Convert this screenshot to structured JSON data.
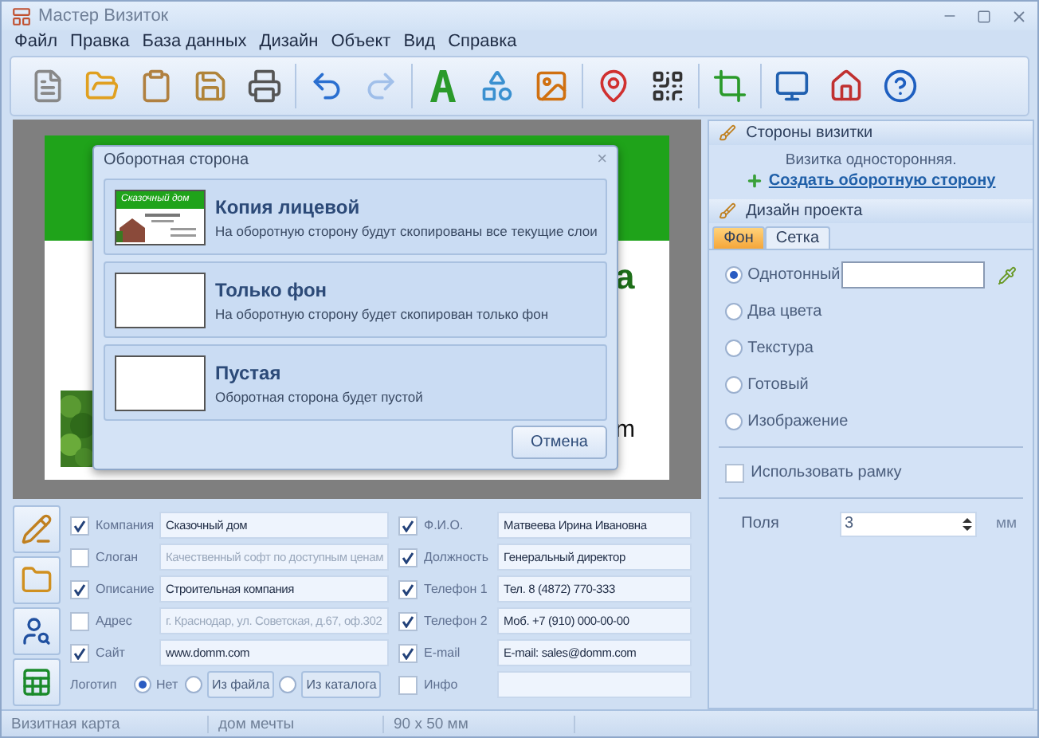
{
  "window": {
    "title": "Мастер Визиток"
  },
  "menu": [
    "Файл",
    "Правка",
    "База данных",
    "Дизайн",
    "Объект",
    "Вид",
    "Справка"
  ],
  "toolbar": [
    [
      {
        "disabled": false
      },
      {
        "disabled": false
      },
      {
        "disabled": false
      },
      {
        "disabled": false
      },
      {
        "disabled": false
      }
    ],
    [
      {
        "disabled": false
      },
      {
        "disabled": true
      }
    ],
    [
      {
        "disabled": false
      },
      {
        "disabled": false
      },
      {
        "disabled": false
      }
    ],
    [
      {
        "disabled": false
      },
      {
        "disabled": false
      }
    ],
    [
      {
        "disabled": false
      }
    ],
    [
      {
        "disabled": false
      },
      {
        "disabled": false
      },
      {
        "disabled": false
      }
    ]
  ],
  "card": {
    "fragments": [
      {
        "text": "а",
        "kind": "title"
      },
      {
        "text": "m",
        "kind": "line"
      }
    ]
  },
  "dialog": {
    "title": "Оборотная сторона",
    "close": "×",
    "options": [
      {
        "kind": "copy",
        "title": "Копия лицевой",
        "description": "На оборотную сторону будут скопированы все текущие слои",
        "preview_title": "Сказочный дом"
      },
      {
        "kind": "blank",
        "title": "Только фон",
        "description": "На оборотную сторону будет скопирован только фон"
      },
      {
        "kind": "blank",
        "title": "Пустая",
        "description": "Оборотная сторона будет пустой"
      }
    ],
    "cancel": "Отмена"
  },
  "form": {
    "left": [
      {
        "label": "Компания",
        "checked": true,
        "value": "Сказочный дом"
      },
      {
        "label": "Слоган",
        "checked": false,
        "value": "Качественный софт по доступным ценам"
      },
      {
        "label": "Описание",
        "checked": true,
        "value": "Строительная компания"
      },
      {
        "label": "Адрес",
        "checked": false,
        "value": "г. Краснодар, ул. Советская, д.67, оф.302"
      },
      {
        "label": "Сайт",
        "checked": true,
        "value": "www.domm.com"
      }
    ],
    "right": [
      {
        "label": "Ф.И.О.",
        "checked": true,
        "value": "Матвеева Ирина Ивановна"
      },
      {
        "label": "Должность",
        "checked": true,
        "value": "Генеральный директор"
      },
      {
        "label": "Телефон 1",
        "checked": true,
        "value": "Тел. 8 (4872) 770-333"
      },
      {
        "label": "Телефон 2",
        "checked": true,
        "value": "Моб. +7 (910) 000-00-00"
      },
      {
        "label": "E-mail",
        "checked": true,
        "value": "E-mail: sales@domm.com"
      },
      {
        "label": "Инфо",
        "checked": false
      }
    ],
    "logo": {
      "label": "Логотип",
      "options": [
        {
          "kind": "radio",
          "label": "Нет",
          "selected": true
        },
        {
          "kind": "button",
          "label": "Из файла",
          "selected": false
        },
        {
          "kind": "button",
          "label": "Из каталога",
          "selected": false
        }
      ]
    }
  },
  "panel": {
    "sides": {
      "title": "Стороны визитки",
      "status": "Визитка односторонняя.",
      "link": "Создать оборотную сторону"
    },
    "design": {
      "title": "Дизайн проекта",
      "tabs": [
        {
          "label": "Фон",
          "selected": true
        },
        {
          "label": "Сетка",
          "selected": false
        }
      ],
      "fill_options": [
        {
          "label": "Однотонный",
          "selected": true
        },
        {
          "label": "Два цвета",
          "selected": false
        },
        {
          "label": "Текстура",
          "selected": false
        },
        {
          "label": "Готовый",
          "selected": false
        },
        {
          "label": "Изображение",
          "selected": false
        }
      ],
      "frame": {
        "label": "Использовать рамку",
        "checked": false
      },
      "margins": {
        "label": "Поля",
        "value": "3",
        "unit": "мм"
      }
    }
  },
  "status_bar": [
    "Визитная карта",
    "дом мечты",
    "90 x 50 мм"
  ]
}
